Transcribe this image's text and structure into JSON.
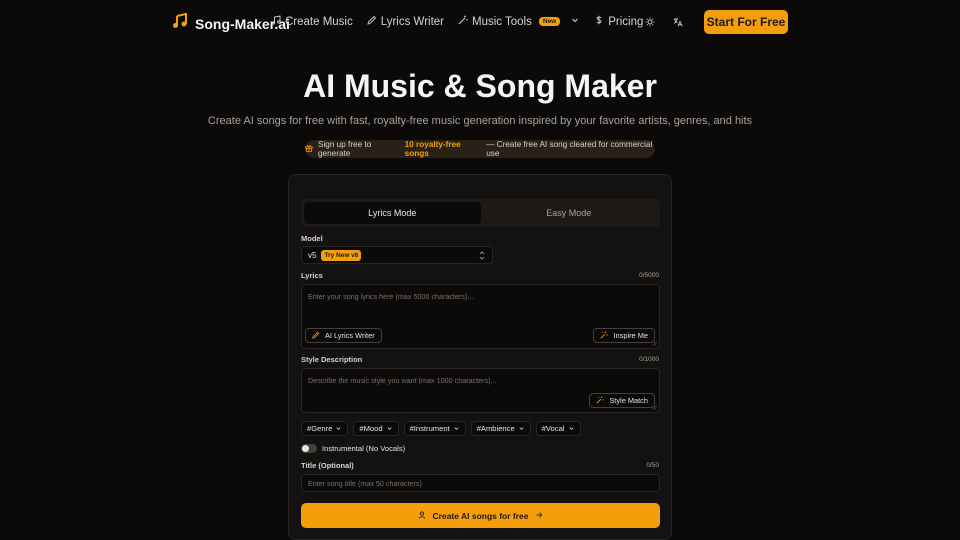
{
  "brand": {
    "name": "Song-Maker.ai",
    "logo_icon": "music-note-icon"
  },
  "nav": {
    "items": [
      {
        "label": "Create Music",
        "icon": "music-note-icon"
      },
      {
        "label": "Lyrics Writer",
        "icon": "pencil-icon"
      },
      {
        "label": "Music Tools",
        "icon": "wand-icon",
        "badge": "New"
      },
      {
        "label": "Pricing",
        "icon": "dollar-icon"
      }
    ]
  },
  "header": {
    "theme_icon": "sun-icon",
    "language_icon": "translate-icon",
    "cta_label": "Start For Free"
  },
  "hero": {
    "title": "AI Music & Song Maker",
    "subtitle": "Create AI songs for free with fast, royalty-free music generation inspired by your favorite artists, genres, and hits"
  },
  "promo": {
    "icon": "gift-icon",
    "prefix": "Sign up free to generate",
    "highlight": "10 royalty-free songs",
    "suffix": "— Create free AI song cleared for commercial use"
  },
  "form": {
    "tabs": [
      {
        "label": "Lyrics Mode",
        "active": true
      },
      {
        "label": "Easy Mode",
        "active": false
      }
    ],
    "model": {
      "label": "Model",
      "value": "v5",
      "badge": "Try New v6"
    },
    "lyrics": {
      "label": "Lyrics",
      "counter": "0/5000",
      "placeholder": "Enter your song lyrics here (max 5000 characters)...",
      "writer_button": "AI Lyrics Writer",
      "inspire_button": "Inspire Me"
    },
    "style": {
      "label": "Style Description",
      "counter": "0/1000",
      "placeholder": "Describe the music style you want (max 1000 characters)...",
      "match_button": "Style Match"
    },
    "tags": [
      "#Genre",
      "#Mood",
      "#Instrument",
      "#Ambience",
      "#Vocal"
    ],
    "instrumental": {
      "label": "Instrumental (No Vocals)",
      "on": false
    },
    "title": {
      "label": "Title (Optional)",
      "counter": "0/50",
      "placeholder": "Enter song title (max 50 characters)"
    },
    "submit_label": "Create AI songs for free"
  },
  "colors": {
    "accent": "#f59e0b",
    "background": "#0c0a09",
    "card": "#141210"
  }
}
